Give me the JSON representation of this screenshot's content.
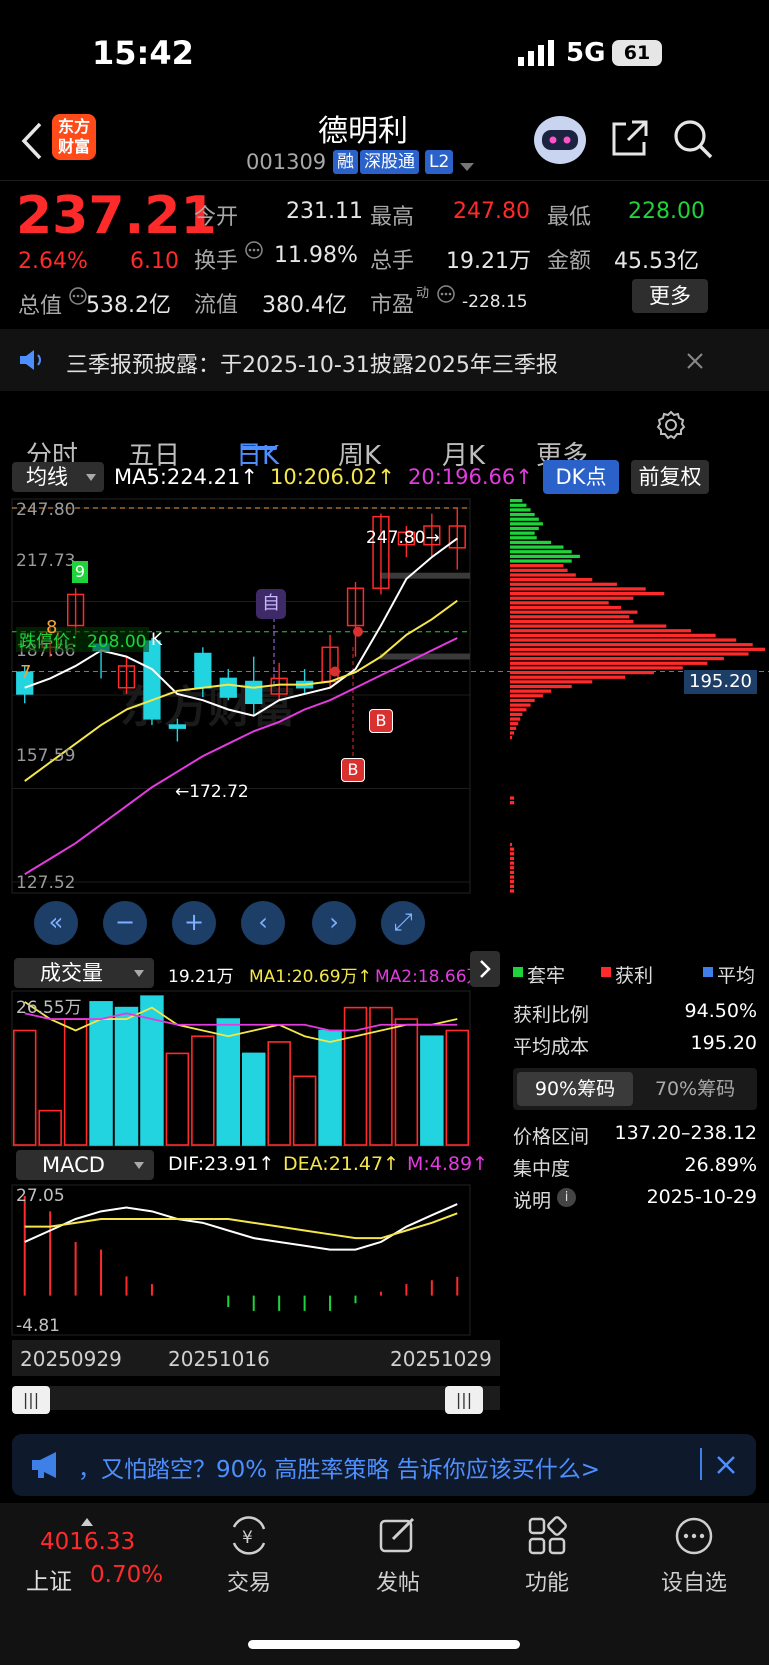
{
  "status_bar": {
    "time": "15:42",
    "network": "5G",
    "battery": "61"
  },
  "header": {
    "logo_line1": "东方",
    "logo_line2": "财富",
    "stock_name": "德明利",
    "stock_code": "001309",
    "badges": [
      "融",
      "深股通",
      "L2"
    ]
  },
  "quote": {
    "price": "237.21",
    "change_pct": "2.64%",
    "change_amt": "6.10",
    "fields": {
      "open_label": "今开",
      "open": "231.11",
      "high_label": "最高",
      "high": "247.80",
      "low_label": "最低",
      "low": "228.00",
      "turnover_label": "换手",
      "turnover": "11.98%",
      "volume_label": "总手",
      "volume": "19.21万",
      "amount_label": "金额",
      "amount": "45.53亿",
      "mktcap_label": "总值",
      "mktcap": "538.2亿",
      "float_label": "流值",
      "float": "380.4亿",
      "pe_label": "市盈",
      "pe_sup": "动",
      "pe": "-228.15"
    },
    "more_button": "更多"
  },
  "notice": {
    "text": "三季报预披露：于2025-10-31披露2025年三季报"
  },
  "tabs": [
    "分时",
    "五日",
    "日K",
    "周K",
    "月K",
    "更多"
  ],
  "active_tab": 2,
  "kline": {
    "ma_selector": "均线",
    "ma5": "MA5:224.21↑",
    "ma10": "10:206.02↑",
    "ma20": "20:196.66↑",
    "dk_button": "DK点",
    "adjust_button": "前复权",
    "y_labels": [
      "247.80",
      "217.73",
      "187.66",
      "157.59",
      "127.52"
    ],
    "max_label": "247.80→",
    "min_label": "←172.72",
    "limit_down": "跌停价：208.00",
    "cost_label": "195.20",
    "marker_9": "9",
    "marker_8": "8",
    "marker_7": "7",
    "marker_zi": "自",
    "marker_k": "K",
    "marker_b": "B",
    "watermark": "东方财富"
  },
  "chip_panel": {
    "legend": [
      "套牢",
      "获利",
      "平均"
    ],
    "profit_ratio_label": "获利比例",
    "profit_ratio": "94.50%",
    "avg_cost_label": "平均成本",
    "avg_cost": "195.20",
    "tab1": "90%筹码",
    "tab2": "70%筹码",
    "price_range_label": "价格区间",
    "price_range": "137.20–238.12",
    "concentration_label": "集中度",
    "concentration": "26.89%",
    "note_label": "说明",
    "note_date": "2025-10-29"
  },
  "volume": {
    "selector": "成交量",
    "vol": "19.21万",
    "ma1": "MA1:20.69万↑",
    "ma2": "MA2:18.66万↑",
    "y_label": "26.55万"
  },
  "macd": {
    "selector": "MACD",
    "dif": "DIF:23.91↑",
    "dea": "DEA:21.47↑",
    "m": "M:4.89↑",
    "y_top": "27.05",
    "y_bottom": "-4.81"
  },
  "x_dates": [
    "20250929",
    "20251016",
    "20251029"
  ],
  "ad_banner": {
    "text": "，又怕踏空？90% 高胜率策略 告诉你应该买什么>"
  },
  "bottom_nav": {
    "index_value": "4016.33",
    "index_name": "上证",
    "index_change": "0.70%",
    "items": [
      "交易",
      "发帖",
      "功能",
      "设自选"
    ]
  },
  "colors": {
    "up": "#ff2a2a",
    "down": "#1fd33b",
    "accent": "#4e8fff",
    "cyan": "#22d3e0"
  },
  "chart_data": {
    "type": "candlestick",
    "candles": [
      {
        "o": 195,
        "c": 188,
        "h": 197,
        "l": 185
      },
      {
        "o": 203,
        "c": 208,
        "h": 210,
        "l": 200
      },
      {
        "o": 210,
        "c": 220,
        "h": 222,
        "l": 207
      },
      {
        "o": 204,
        "c": 202,
        "h": 206,
        "l": 193
      },
      {
        "o": 190,
        "c": 197,
        "h": 200,
        "l": 188
      },
      {
        "o": 205,
        "c": 180,
        "h": 206,
        "l": 178
      },
      {
        "o": 178,
        "c": 177,
        "h": 180,
        "l": 172.72
      },
      {
        "o": 201,
        "c": 190,
        "h": 203,
        "l": 187
      },
      {
        "o": 193,
        "c": 187,
        "h": 196,
        "l": 186
      },
      {
        "o": 192,
        "c": 185,
        "h": 200,
        "l": 181
      },
      {
        "o": 188,
        "c": 193,
        "h": 198,
        "l": 186
      },
      {
        "o": 192,
        "c": 190,
        "h": 196,
        "l": 188
      },
      {
        "o": 192,
        "c": 203,
        "h": 207,
        "l": 190
      },
      {
        "o": 210,
        "c": 222,
        "h": 224,
        "l": 200
      },
      {
        "o": 222,
        "c": 245,
        "h": 246,
        "l": 220
      },
      {
        "o": 236,
        "c": 240,
        "h": 242,
        "l": 232
      },
      {
        "o": 236,
        "c": 242,
        "h": 246,
        "l": 232
      },
      {
        "o": 235,
        "c": 242,
        "h": 247.8,
        "l": 228
      }
    ],
    "ma5": [
      190,
      193,
      197,
      202,
      200,
      196,
      188,
      186,
      183,
      181,
      186,
      188,
      190,
      196,
      210,
      225,
      232,
      238
    ],
    "ma10": [
      160,
      166,
      172,
      178,
      183,
      186,
      189,
      190,
      191,
      190,
      191,
      191,
      192,
      195,
      200,
      207,
      212,
      218
    ],
    "ma20": [
      130,
      135,
      140,
      146,
      152,
      158,
      163,
      168,
      172,
      176,
      179,
      183,
      186,
      190,
      194,
      198,
      202,
      206
    ],
    "volume_wan": [
      20,
      6,
      22,
      25,
      24,
      26,
      16,
      19,
      22,
      16,
      18,
      12,
      20,
      24,
      24,
      22,
      19,
      20
    ],
    "volume_up": [
      true,
      true,
      true,
      false,
      false,
      false,
      true,
      true,
      false,
      false,
      true,
      true,
      false,
      true,
      true,
      true,
      false,
      true
    ],
    "volume_ma1": [
      25,
      22,
      20,
      22,
      22,
      24,
      21,
      20,
      19,
      20,
      21,
      19,
      18,
      19,
      20,
      21,
      21,
      22
    ],
    "volume_ma2": [
      23,
      22,
      22,
      22,
      23,
      22,
      21,
      21,
      21,
      21,
      21,
      21,
      20,
      20,
      21,
      21,
      21,
      21
    ],
    "macd_dif": [
      14,
      17,
      20,
      22,
      23,
      22,
      20,
      19,
      17,
      15,
      14,
      13,
      12,
      12,
      14,
      18,
      21,
      23.91
    ],
    "macd_dea": [
      18,
      18,
      19,
      20,
      20,
      20,
      20,
      20,
      20,
      19,
      18,
      17,
      16,
      15,
      15,
      17,
      19,
      21.47
    ],
    "macd_m": [
      26,
      22,
      14,
      12,
      5,
      3,
      0,
      0,
      -3,
      -4,
      -4,
      -4,
      -4,
      -2,
      1,
      3,
      4,
      4.89
    ],
    "ylim": [
      127.52,
      247.8
    ],
    "chips": {
      "profit_ratio": 94.5,
      "avg_cost": 195.2,
      "price_min": 127.52,
      "price_max": 247.8,
      "bins": [
        6,
        8,
        10,
        12,
        14,
        16,
        14,
        12,
        13,
        20,
        26,
        30,
        34,
        30,
        26,
        28,
        32,
        40,
        52,
        66,
        75,
        60,
        48,
        54,
        62,
        58,
        60,
        76,
        88,
        100,
        110,
        118,
        124,
        116,
        104,
        96,
        84,
        70,
        56,
        40,
        30,
        20,
        16,
        12,
        10,
        8,
        6,
        5,
        4,
        3,
        2,
        1,
        0,
        0,
        0,
        0,
        0,
        0,
        0,
        0,
        0,
        0,
        0,
        0,
        2,
        2,
        0,
        0,
        0,
        0,
        0,
        0,
        0,
        0,
        1,
        2,
        2,
        2,
        2,
        2,
        2,
        2,
        2,
        2,
        2
      ],
      "profit_split_index": 14
    }
  }
}
